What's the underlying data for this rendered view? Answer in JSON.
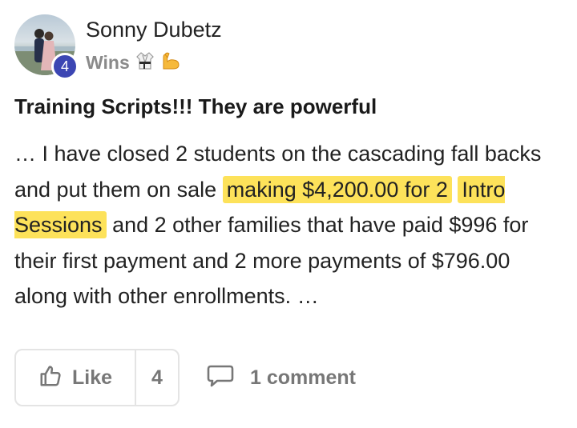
{
  "author": {
    "name": "Sonny Dubetz",
    "level": "4"
  },
  "post": {
    "category": "Wins",
    "category_emojis": [
      "martial-arts-uniform-icon",
      "flexed-biceps-icon"
    ],
    "title": "Training Scripts!!! They are powerful",
    "body": {
      "part1": "… I have closed 2 students on the cascading fall backs and put them on sale ",
      "highlight1": "making $4,200.00 for 2",
      "highlight2": "Intro Sessions",
      "part2": " and 2 other families that have paid $996 for their first payment and 2 more payments of $796.00 along with other enrollments. …"
    }
  },
  "actions": {
    "like_label": "Like",
    "like_count": "4",
    "comment_label": "1 comment"
  },
  "colors": {
    "highlight": "#fde25a",
    "level_badge": "#3c46b3",
    "muted_text": "#777777"
  }
}
